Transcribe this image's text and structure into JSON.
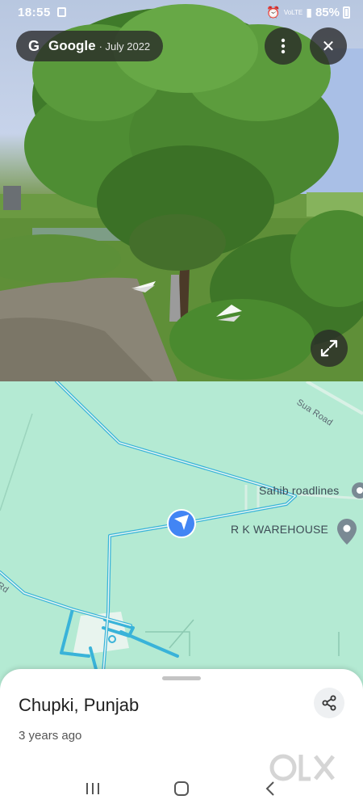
{
  "status_bar": {
    "time": "18:55",
    "battery": "85%",
    "network": "VoLTE"
  },
  "imagery_pill": {
    "brand": "Google",
    "date": "· July 2022"
  },
  "buttons": {
    "more_icon": "more-vert-icon",
    "close_glyph": "✕",
    "expand_icon": "expand-icon"
  },
  "map": {
    "labels": {
      "sahib": "Sahib roadlines",
      "rk": "R K WAREHOUSE",
      "road": "Sua Road",
      "rd": "l Rd"
    },
    "colors": {
      "land": "#b4ead3",
      "route": "#39b3d9",
      "arrow": "#4285f4"
    }
  },
  "sheet": {
    "title": "Chupki, Punjab",
    "subtitle": "3 years ago"
  },
  "watermark": {
    "text": "OLX"
  },
  "navbar": {
    "recents_icon": "recents-icon",
    "home_icon": "home-icon",
    "back_icon": "back-icon"
  }
}
